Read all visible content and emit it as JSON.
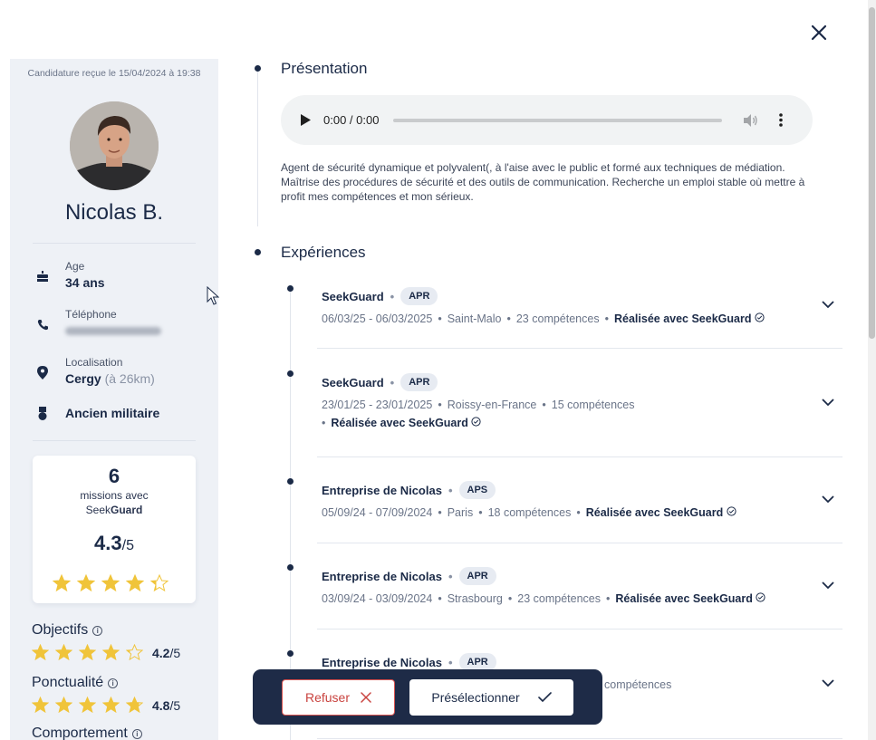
{
  "candidate": {
    "received": "Candidature reçue le 15/04/2024 à 19:38",
    "name": "Nicolas B.",
    "age_label": "Age",
    "age_value": "34 ans",
    "phone_label": "Téléphone",
    "location_label": "Localisation",
    "location_city": "Cergy",
    "location_distance": "(à 26km)",
    "military": "Ancien militaire"
  },
  "stats": {
    "missions_count": "6",
    "missions_text": "missions avec",
    "brand_prefix": "Seek",
    "brand_suffix": "Guard",
    "rating": "4.3",
    "rating_den": "/5",
    "rating_value": 4.3
  },
  "criteria": [
    {
      "title": "Objectifs",
      "score": "4.2",
      "den": "/5",
      "value": 4.2
    },
    {
      "title": "Ponctualité",
      "score": "4.8",
      "den": "/5",
      "value": 4.8
    },
    {
      "title": "Comportement"
    }
  ],
  "presentation": {
    "title": "Présentation",
    "audio_time": "0:00 / 0:00",
    "text": "Agent de sécurité dynamique et polyvalent(, à l'aise avec le public et formé aux techniques de médiation. Maîtrise des procédures de sécurité et des outils de communication. Recherche un emploi stable où mettre à profit mes compétences et mon sérieux."
  },
  "experiences": {
    "title": "Expériences",
    "items": [
      {
        "company": "SeekGuard",
        "tag": "APR",
        "dates": "06/03/25 - 06/03/2025",
        "city": "Saint-Malo",
        "skills": "23 compétences",
        "realised": "Réalisée avec SeekGuard"
      },
      {
        "company": "SeekGuard",
        "tag": "APR",
        "dates": "23/01/25 - 23/01/2025",
        "city": "Roissy-en-France",
        "skills": "15 compétences",
        "realised": "Réalisée avec SeekGuard"
      },
      {
        "company": "Entreprise de Nicolas",
        "tag": "APS",
        "dates": "05/09/24 - 07/09/2024",
        "city": "Paris",
        "skills": "18 compétences",
        "realised": "Réalisée avec SeekGuard"
      },
      {
        "company": "Entreprise de Nicolas",
        "tag": "APR",
        "dates": "03/09/24 - 03/09/2024",
        "city": "Strasbourg",
        "skills": "23 compétences",
        "realised": "Réalisée avec SeekGuard"
      },
      {
        "company": "Entreprise de Nicolas",
        "tag": "APR",
        "skills_partial": "compétences"
      }
    ]
  },
  "actions": {
    "refuse": "Refuser",
    "preselect": "Présélectionner"
  },
  "colors": {
    "navy": "#1e2b47",
    "sidebar_bg": "#eef1f6",
    "star": "#f0c43a",
    "refuse": "#d9534f"
  }
}
